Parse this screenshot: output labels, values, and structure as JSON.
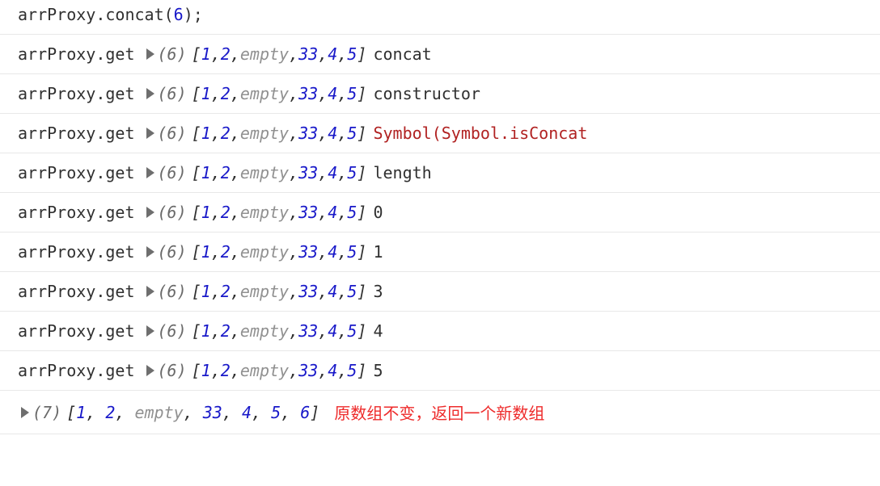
{
  "input": {
    "prefix": "arrProxy.concat(",
    "arg": "6",
    "suffix": ");"
  },
  "arrayBase": {
    "count": "(6)",
    "items": [
      {
        "t": "num",
        "v": "1"
      },
      {
        "t": "num",
        "v": "2"
      },
      {
        "t": "gray",
        "v": "empty"
      },
      {
        "t": "num",
        "v": "33"
      },
      {
        "t": "num",
        "v": "4"
      },
      {
        "t": "num",
        "v": "5"
      }
    ]
  },
  "lines": [
    {
      "prefix": "arrProxy.get",
      "prop": "concat",
      "kind": "prop"
    },
    {
      "prefix": "arrProxy.get",
      "prop": "constructor",
      "kind": "prop"
    },
    {
      "prefix": "arrProxy.get",
      "prop": "Symbol(Symbol.isConcat",
      "kind": "sym"
    },
    {
      "prefix": "arrProxy.get",
      "prop": "length",
      "kind": "prop"
    },
    {
      "prefix": "arrProxy.get",
      "prop": "0",
      "kind": "prop"
    },
    {
      "prefix": "arrProxy.get",
      "prop": "1",
      "kind": "prop"
    },
    {
      "prefix": "arrProxy.get",
      "prop": "3",
      "kind": "prop"
    },
    {
      "prefix": "arrProxy.get",
      "prop": "4",
      "kind": "prop"
    },
    {
      "prefix": "arrProxy.get",
      "prop": "5",
      "kind": "prop"
    }
  ],
  "result": {
    "count": "(7)",
    "items": [
      {
        "t": "num",
        "v": "1"
      },
      {
        "t": "num",
        "v": "2"
      },
      {
        "t": "gray",
        "v": "empty"
      },
      {
        "t": "num",
        "v": "33"
      },
      {
        "t": "num",
        "v": "4"
      },
      {
        "t": "num",
        "v": "5"
      },
      {
        "t": "num",
        "v": "6"
      }
    ],
    "annotation": "原数组不变，返回一个新数组"
  }
}
